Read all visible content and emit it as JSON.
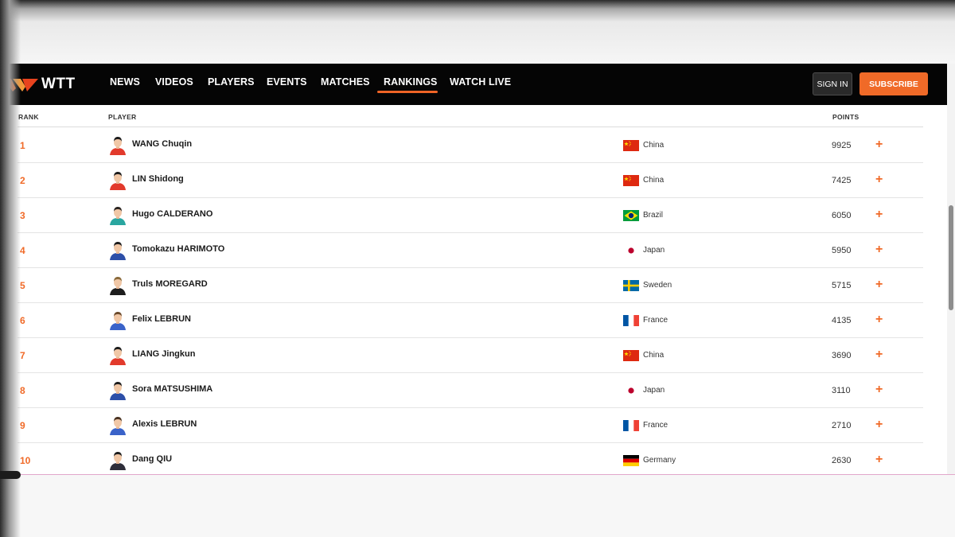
{
  "nav": {
    "logo_text": "WTT",
    "items": [
      {
        "label": "NEWS",
        "active": false
      },
      {
        "label": "VIDEOS",
        "active": false
      },
      {
        "label": "PLAYERS",
        "active": false
      },
      {
        "label": "EVENTS",
        "active": false
      },
      {
        "label": "MATCHES",
        "active": false
      },
      {
        "label": "RANKINGS",
        "active": true
      },
      {
        "label": "WATCH LIVE",
        "active": false
      }
    ],
    "sign_in": "SIGN IN",
    "subscribe": "SUBSCRIBE"
  },
  "table": {
    "headers": {
      "rank": "RANK",
      "player": "PLAYER",
      "points": "POINTS"
    },
    "rows": [
      {
        "rank": "1",
        "name": "WANG Chuqin",
        "country": "China",
        "flag": "flag-china",
        "points": "9925",
        "avatar_shirt": "#e23a2c",
        "avatar_hair": "#1c1c1c"
      },
      {
        "rank": "2",
        "name": "LIN Shidong",
        "country": "China",
        "flag": "flag-china",
        "points": "7425",
        "avatar_shirt": "#e23a2c",
        "avatar_hair": "#1c1c1c"
      },
      {
        "rank": "3",
        "name": "Hugo CALDERANO",
        "country": "Brazil",
        "flag": "flag-brazil",
        "points": "6050",
        "avatar_shirt": "#2aa6a0",
        "avatar_hair": "#2a2420"
      },
      {
        "rank": "4",
        "name": "Tomokazu HARIMOTO",
        "country": "Japan",
        "flag": "flag-japan",
        "points": "5950",
        "avatar_shirt": "#2d4fa8",
        "avatar_hair": "#1c1c1c"
      },
      {
        "rank": "5",
        "name": "Truls MOREGARD",
        "country": "Sweden",
        "flag": "flag-sweden",
        "points": "5715",
        "avatar_shirt": "#1d1d1d",
        "avatar_hair": "#8a6a3a"
      },
      {
        "rank": "6",
        "name": "Felix LEBRUN",
        "country": "France",
        "flag": "flag-france",
        "points": "4135",
        "avatar_shirt": "#3a63c9",
        "avatar_hair": "#6b4a2b"
      },
      {
        "rank": "7",
        "name": "LIANG Jingkun",
        "country": "China",
        "flag": "flag-china",
        "points": "3690",
        "avatar_shirt": "#e23a2c",
        "avatar_hair": "#1c1c1c"
      },
      {
        "rank": "8",
        "name": "Sora MATSUSHIMA",
        "country": "Japan",
        "flag": "flag-japan",
        "points": "3110",
        "avatar_shirt": "#2d4fa8",
        "avatar_hair": "#1c1c1c"
      },
      {
        "rank": "9",
        "name": "Alexis LEBRUN",
        "country": "France",
        "flag": "flag-france",
        "points": "2710",
        "avatar_shirt": "#3a63c9",
        "avatar_hair": "#4a3322"
      },
      {
        "rank": "10",
        "name": "Dang QIU",
        "country": "Germany",
        "flag": "flag-germany",
        "points": "2630",
        "avatar_shirt": "#2e2e3a",
        "avatar_hair": "#1c1c1c"
      }
    ],
    "expand_symbol": "+"
  },
  "colors": {
    "accent": "#f06a28",
    "nav_background": "#050505",
    "china_red": "#de2910",
    "china_yellow": "#ffde00",
    "brazil_green": "#009c3b",
    "brazil_yellow": "#ffdf00",
    "brazil_blue": "#002776",
    "japan_red": "#bc002d",
    "sweden_blue": "#006aa7",
    "sweden_yellow": "#fecc00",
    "france_blue": "#0055a4",
    "france_red": "#ef4135",
    "germany_red": "#dd0000",
    "germany_gold": "#ffce00"
  }
}
